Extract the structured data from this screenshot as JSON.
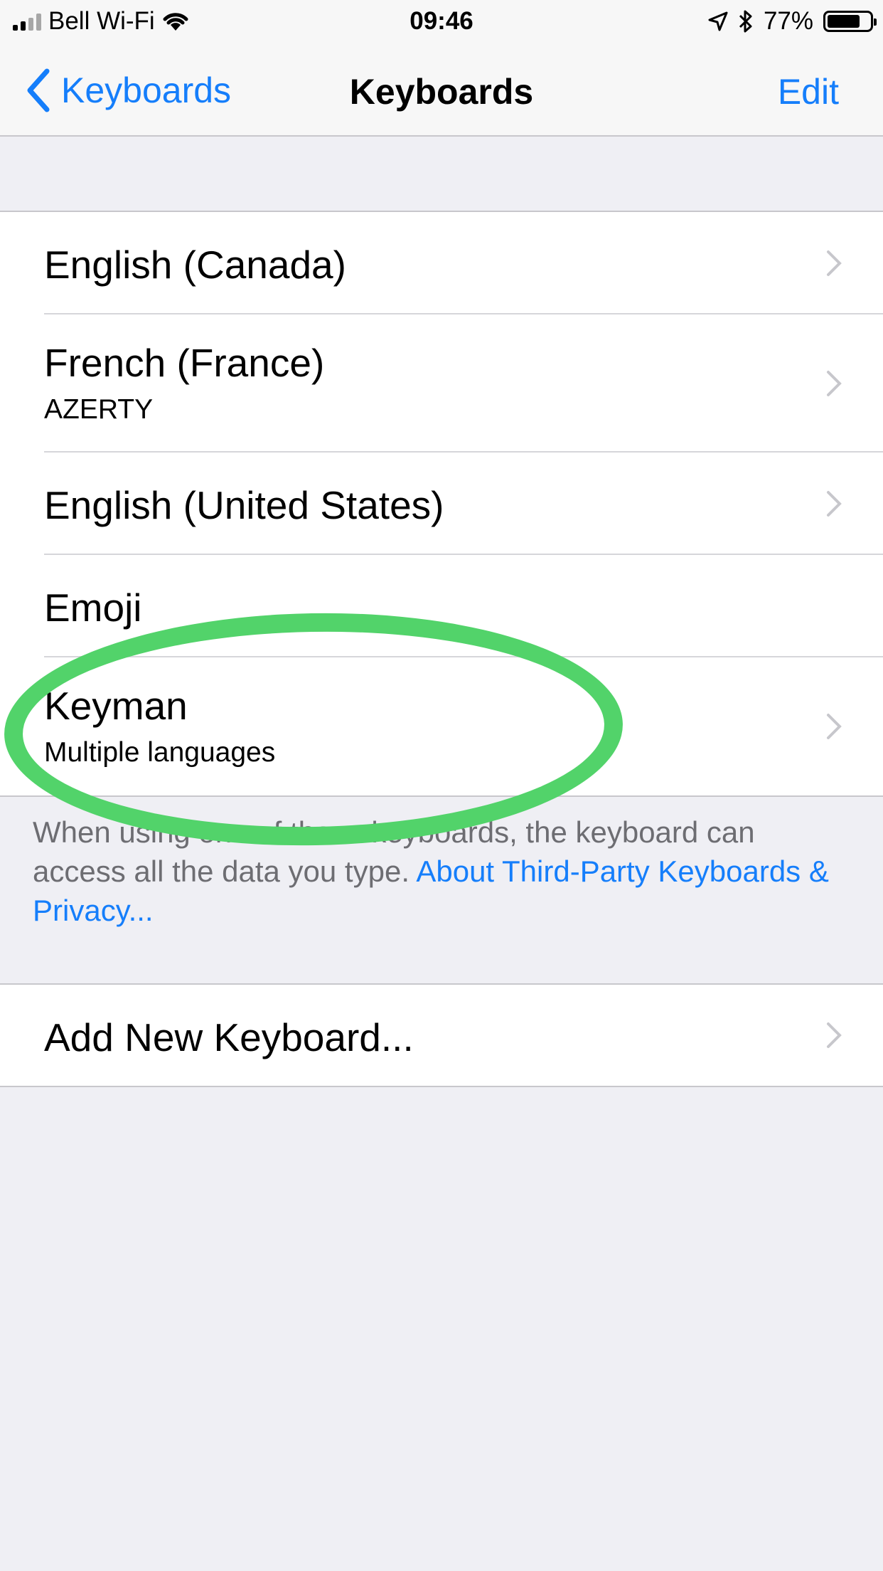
{
  "status_bar": {
    "carrier": "Bell Wi-Fi",
    "time": "09:46",
    "battery": "77%",
    "battery_level": 0.77,
    "icons": [
      "signal-bars-icon",
      "wifi-icon",
      "location-arrow-icon",
      "bluetooth-icon",
      "battery-icon"
    ]
  },
  "nav": {
    "back_label": "Keyboards",
    "title": "Keyboards",
    "edit_label": "Edit"
  },
  "keyboards": [
    {
      "title": "English (Canada)",
      "subtitle": ""
    },
    {
      "title": "French (France)",
      "subtitle": "AZERTY"
    },
    {
      "title": "English (United States)",
      "subtitle": ""
    },
    {
      "title": "Emoji",
      "subtitle": ""
    },
    {
      "title": "Keyman",
      "subtitle": "Multiple languages"
    }
  ],
  "footer": {
    "text": "When using one of these keyboards, the keyboard can access all the data you type. ",
    "link": "About Third-Party Keyboards & Privacy..."
  },
  "add_keyboard": {
    "label": "Add New Keyboard..."
  },
  "colors": {
    "accent": "#157efb",
    "highlight": "#52d36a",
    "background": "#efeff4"
  }
}
